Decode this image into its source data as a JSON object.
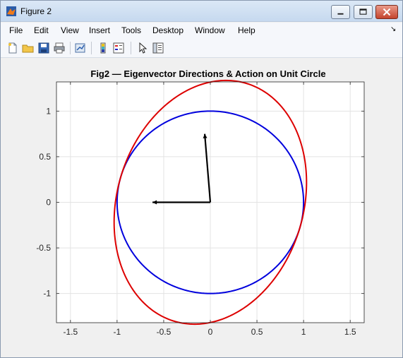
{
  "window": {
    "title": "Figure 2",
    "minimize_label": "Minimize",
    "maximize_label": "Maximize",
    "close_label": "Close"
  },
  "menu": {
    "items": [
      "File",
      "Edit",
      "View",
      "Insert",
      "Tools",
      "Desktop",
      "Window",
      "Help"
    ]
  },
  "toolbar": {
    "buttons": [
      "new-figure",
      "open-file",
      "save",
      "print",
      "link-plot",
      "colorbar",
      "legend",
      "pointer",
      "property-inspector"
    ]
  },
  "chart_data": {
    "type": "line",
    "title": "Fig2 — Eigenvector Directions & Action on Unit Circle",
    "xlabel": "",
    "ylabel": "",
    "xlim": [
      -1.65,
      1.65
    ],
    "ylim": [
      -1.32,
      1.32
    ],
    "xticks": [
      -1.5,
      -1,
      -0.5,
      0,
      0.5,
      1,
      1.5
    ],
    "xtick_labels": [
      "-1.5",
      "-1",
      "-0.5",
      "0",
      "0.5",
      "1",
      "1.5"
    ],
    "yticks": [
      -1,
      -0.5,
      0,
      0.5,
      1
    ],
    "ytick_labels": [
      "-1",
      "-0.5",
      "0",
      "0.5",
      "1"
    ],
    "grid": true,
    "series": [
      {
        "kind": "unit_circle",
        "color": "#0000dd",
        "center": [
          0,
          0
        ],
        "radius": 1.0
      },
      {
        "kind": "transformed_ellipse",
        "color": "#dd0000",
        "semi_major": 1.36,
        "semi_minor": 1.0,
        "major_axis_angle_deg": 74
      },
      {
        "kind": "eigenvector",
        "color": "#000000",
        "from": [
          0,
          0
        ],
        "to": [
          -0.62,
          0.0
        ]
      },
      {
        "kind": "eigenvector",
        "color": "#000000",
        "from": [
          0,
          0
        ],
        "to": [
          -0.06,
          0.75
        ]
      }
    ]
  }
}
